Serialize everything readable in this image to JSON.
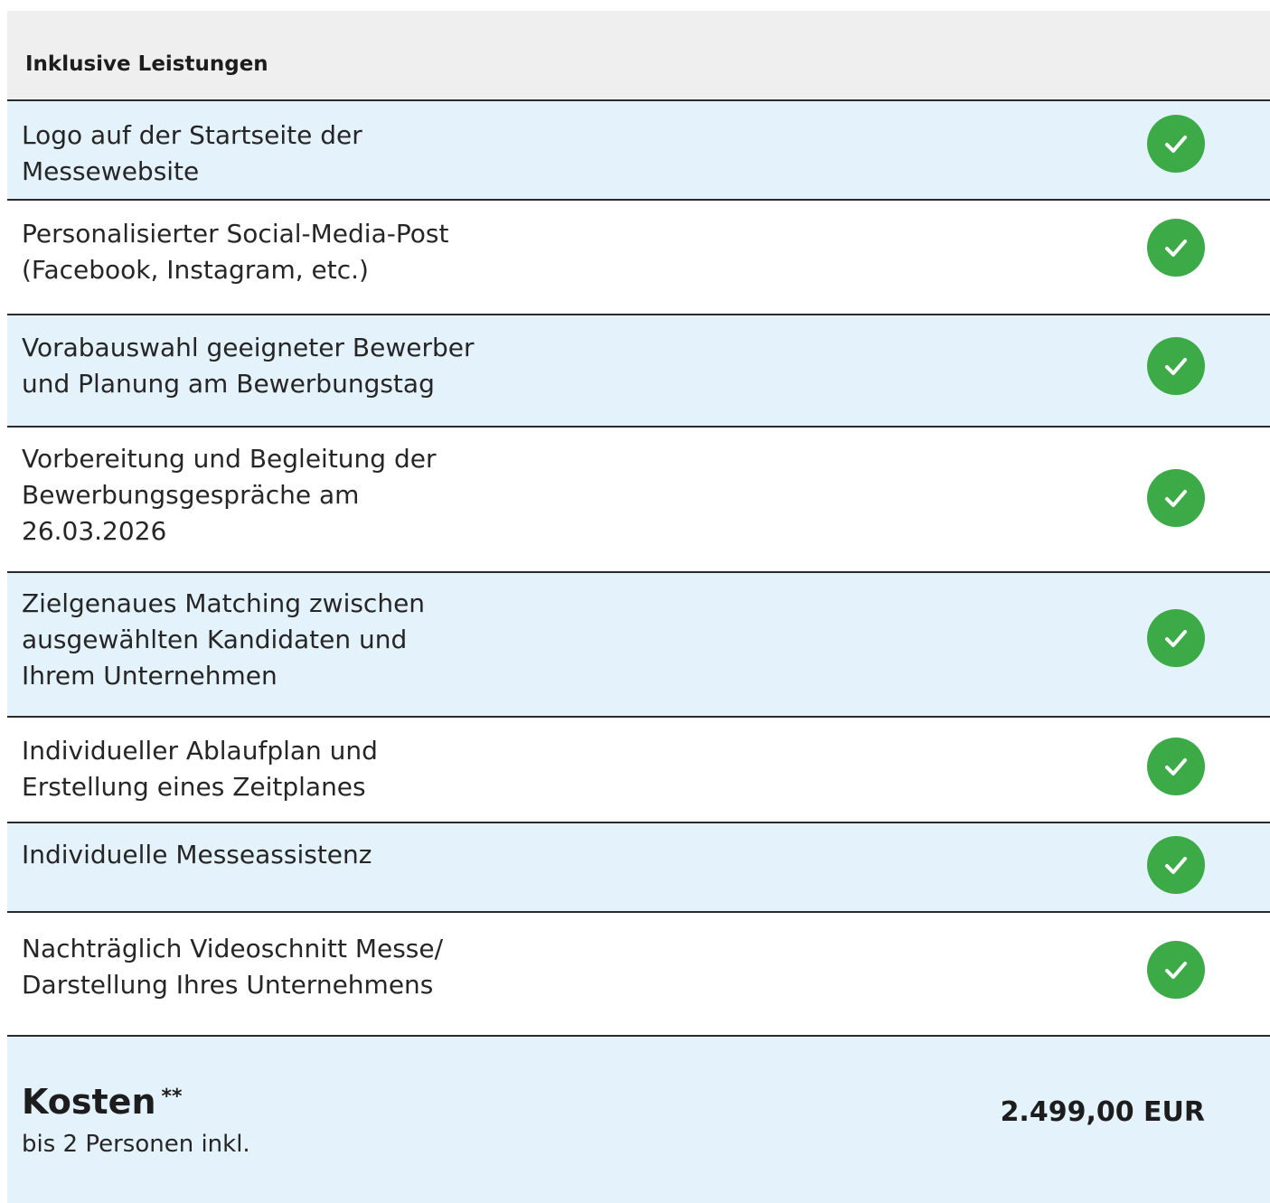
{
  "header": {
    "title": "Inklusive Leistungen"
  },
  "rows": [
    {
      "label": "Logo auf der Startseite der\nMessewebsite",
      "included": true,
      "icon": "check-circle-icon"
    },
    {
      "label": "Personalisierter Social-Media-Post\n(Facebook, Instagram, etc.)",
      "included": true,
      "icon": "check-circle-icon"
    },
    {
      "label": "Vorabauswahl geeigneter Bewerber\nund Planung am Bewerbungstag",
      "included": true,
      "icon": "check-circle-icon"
    },
    {
      "label": "Vorbereitung und Begleitung der\nBewerbungsgespräche am\n26.03.2026",
      "included": true,
      "icon": "check-circle-icon"
    },
    {
      "label": "Zielgenaues Matching zwischen\nausgewählten Kandidaten und\nIhrem Unternehmen",
      "included": true,
      "icon": "check-circle-icon"
    },
    {
      "label": "Individueller Ablaufplan und\nErstellung eines Zeitplanes",
      "included": true,
      "icon": "check-circle-icon"
    },
    {
      "label": "Individuelle Messeassistenz",
      "included": true,
      "icon": "check-circle-icon"
    },
    {
      "label": "Nachträglich Videoschnitt Messe/\nDarstellung Ihres Unternehmens",
      "included": true,
      "icon": "check-circle-icon"
    }
  ],
  "cost": {
    "title": "Kosten",
    "marker": "**",
    "subtitle": "bis 2 Personen inkl.",
    "price": "2.499,00 EUR"
  },
  "colors": {
    "header_bg": "#efefef",
    "row_tint": "#e4f2fb",
    "check_green": "#3daa48",
    "divider": "#2b2b2b"
  }
}
